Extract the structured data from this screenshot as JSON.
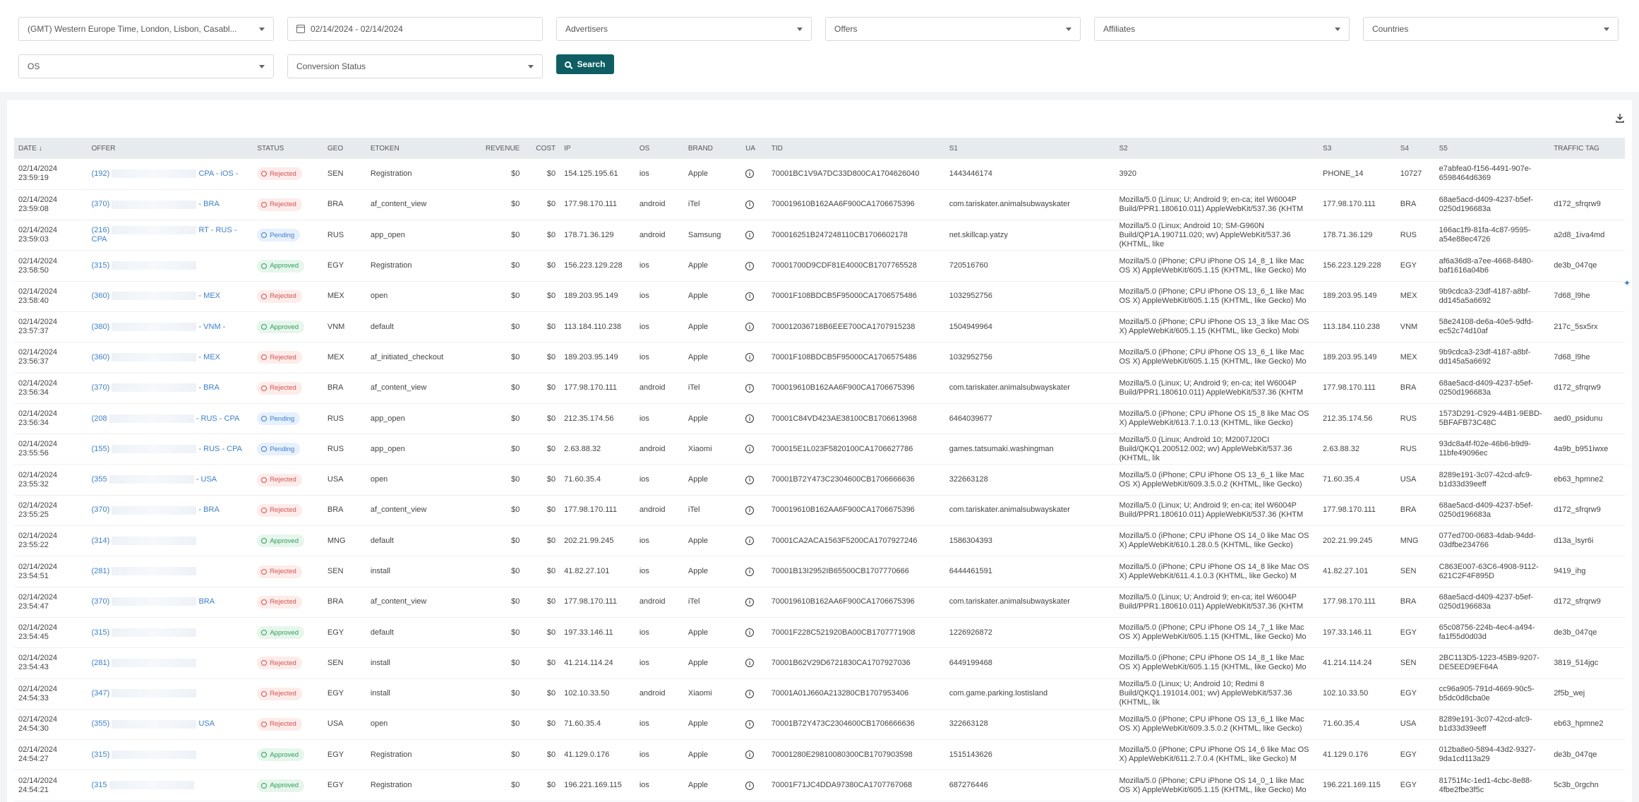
{
  "filters": {
    "timezone": "(GMT) Western Europe Time, London, Lisbon, Casabl...",
    "date_range": "02/14/2024 - 02/14/2024",
    "advertisers": "Advertisers",
    "offers": "Offers",
    "affiliates": "Affiliates",
    "countries": "Countries",
    "os": "OS",
    "conversion_status": "Conversion Status",
    "search_label": "Search"
  },
  "columns": [
    "DATE",
    "OFFER",
    "STATUS",
    "GEO",
    "ETOKEN",
    "REVENUE",
    "COST",
    "IP",
    "OS",
    "BRAND",
    "UA",
    "TID",
    "S1",
    "S2",
    "S3",
    "S4",
    "S5",
    "TRAFFIC TAG"
  ],
  "rows": [
    {
      "date": "02/14/2024",
      "time": "23:59:19",
      "offer_a": "(192)",
      "offer_b": "CPA - iOS -",
      "status": "Rejected",
      "geo": "SEN",
      "etoken": "Registration",
      "revenue": "$0",
      "cost": "$0",
      "ip": "154.125.195.61",
      "os": "ios",
      "brand": "Apple",
      "tid": "70001BC1V9A7DC33D800CA1704626040",
      "s1": "1443446174",
      "s2": "3920",
      "s3": "PHONE_14",
      "s4": "10727",
      "s5": "e7abfea0-f156-4491-907e-6598464d6369",
      "tag": ""
    },
    {
      "date": "02/14/2024",
      "time": "23:59:08",
      "offer_a": "(370)",
      "offer_b": "- BRA",
      "status": "Rejected",
      "geo": "BRA",
      "etoken": "af_content_view",
      "revenue": "$0",
      "cost": "$0",
      "ip": "177.98.170.111",
      "os": "android",
      "brand": "iTel",
      "tid": "700019610B162AA6F900CA1706675396",
      "s1": "com.tariskater.animalsubwayskater",
      "s2": "Mozilla/5.0 (Linux; U; Android 9; en-ca; itel W6004P Build/PPR1.180610.011) AppleWebKit/537.36 (KHTM",
      "s3": "177.98.170.111",
      "s4": "BRA",
      "s5": "68ae5acd-d409-4237-b5ef-0250d196683a",
      "tag": "d172_sfrqrw9"
    },
    {
      "date": "02/14/2024",
      "time": "23:59:03",
      "offer_a": "(216)",
      "offer_b": "RT - RUS - CPA",
      "status": "Pending",
      "geo": "RUS",
      "etoken": "app_open",
      "revenue": "$0",
      "cost": "$0",
      "ip": "178.71.36.129",
      "os": "android",
      "brand": "Samsung",
      "tid": "700016251B247248110CB1706602178",
      "s1": "net.skillcap.yatzy",
      "s2": "Mozilla/5.0 (Linux; Android 10; SM-G960N Build/QP1A.190711.020; wv) AppleWebKit/537.36 (KHTML, like",
      "s3": "178.71.36.129",
      "s4": "RUS",
      "s5": "166ac1f9-81fa-4c87-9595-a54e88ec4726",
      "tag": "a2d8_1iva4md"
    },
    {
      "date": "02/14/2024",
      "time": "23:58:50",
      "offer_a": "(315)",
      "offer_b": "",
      "status": "Approved",
      "geo": "EGY",
      "etoken": "Registration",
      "revenue": "$0",
      "cost": "$0",
      "ip": "156.223.129.228",
      "os": "ios",
      "brand": "Apple",
      "tid": "70001700D9CDF81E4000CB1707765528",
      "s1": "720516760",
      "s2": "Mozilla/5.0 (iPhone; CPU iPhone OS 14_8_1 like Mac OS X) AppleWebKit/605.1.15 (KHTML, like Gecko) Mo",
      "s3": "156.223.129.228",
      "s4": "EGY",
      "s5": "af6a36d8-a7ee-4668-8480-baf1616a04b6",
      "tag": "de3b_047qe"
    },
    {
      "date": "02/14/2024",
      "time": "23:58:40",
      "offer_a": "(360)",
      "offer_b": "- MEX",
      "status": "Rejected",
      "geo": "MEX",
      "etoken": "open",
      "revenue": "$0",
      "cost": "$0",
      "ip": "189.203.95.149",
      "os": "ios",
      "brand": "Apple",
      "tid": "70001F108BDCB5F95000CA1706575486",
      "s1": "1032952756",
      "s2": "Mozilla/5.0 (iPhone; CPU iPhone OS 13_6_1 like Mac OS X) AppleWebKit/605.1.15 (KHTML, like Gecko) Mo",
      "s3": "189.203.95.149",
      "s4": "MEX",
      "s5": "9b9cdca3-23df-4187-a8bf-dd145a5a6692",
      "tag": "7d68_l9he"
    },
    {
      "date": "02/14/2024",
      "time": "23:57:37",
      "offer_a": "(380)",
      "offer_b": "- VNM -",
      "status": "Approved",
      "geo": "VNM",
      "etoken": "default",
      "revenue": "$0",
      "cost": "$0",
      "ip": "113.184.110.238",
      "os": "ios",
      "brand": "Apple",
      "tid": "700012036718B6EEE700CA1707915238",
      "s1": "1504949964",
      "s2": "Mozilla/5.0 (iPhone; CPU iPhone OS 13_3 like Mac OS X) AppleWebKit/605.1.15 (KHTML, like Gecko) Mobi",
      "s3": "113.184.110.238",
      "s4": "VNM",
      "s5": "58e24108-de6a-40e5-9dfd-ec52c74d10af",
      "tag": "217c_5sx5rx"
    },
    {
      "date": "02/14/2024",
      "time": "23:56:37",
      "offer_a": "(360)",
      "offer_b": "- MEX",
      "status": "Rejected",
      "geo": "MEX",
      "etoken": "af_initiated_checkout",
      "revenue": "$0",
      "cost": "$0",
      "ip": "189.203.95.149",
      "os": "ios",
      "brand": "Apple",
      "tid": "70001F108BDCB5F95000CA1706575486",
      "s1": "1032952756",
      "s2": "Mozilla/5.0 (iPhone; CPU iPhone OS 13_6_1 like Mac OS X) AppleWebKit/605.1.15 (KHTML, like Gecko) Mo",
      "s3": "189.203.95.149",
      "s4": "MEX",
      "s5": "9b9cdca3-23df-4187-a8bf-dd145a5a6692",
      "tag": "7d68_l9he"
    },
    {
      "date": "02/14/2024",
      "time": "23:56:34",
      "offer_a": "(370)",
      "offer_b": "- BRA",
      "status": "Rejected",
      "geo": "BRA",
      "etoken": "af_content_view",
      "revenue": "$0",
      "cost": "$0",
      "ip": "177.98.170.111",
      "os": "android",
      "brand": "iTel",
      "tid": "700019610B162AA6F900CA1706675396",
      "s1": "com.tariskater.animalsubwayskater",
      "s2": "Mozilla/5.0 (Linux; U; Android 9; en-ca; itel W6004P Build/PPR1.180610.011) AppleWebKit/537.36 (KHTM",
      "s3": "177.98.170.111",
      "s4": "BRA",
      "s5": "68ae5acd-d409-4237-b5ef-0250d196683a",
      "tag": "d172_sfrqrw9"
    },
    {
      "date": "02/14/2024",
      "time": "23:56:34",
      "offer_a": "(208",
      "offer_b": "- RUS - CPA",
      "status": "Pending",
      "geo": "RUS",
      "etoken": "app_open",
      "revenue": "$0",
      "cost": "$0",
      "ip": "212.35.174.56",
      "os": "ios",
      "brand": "Apple",
      "tid": "70001C84VD423AE38100CB1706613968",
      "s1": "6464039677",
      "s2": "Mozilla/5.0 (iPhone; CPU iPhone OS 15_8 like Mac OS X) AppleWebKit/613.7.1.0.13 (KHTML, like Gecko)",
      "s3": "212.35.174.56",
      "s4": "RUS",
      "s5": "1573D291-C929-44B1-9EBD-5BFAFB73C48C",
      "tag": "aed0_psidunu"
    },
    {
      "date": "02/14/2024",
      "time": "23:55:56",
      "offer_a": "(155)",
      "offer_b": "- RUS - CPA",
      "status": "Pending",
      "geo": "RUS",
      "etoken": "app_open",
      "revenue": "$0",
      "cost": "$0",
      "ip": "2.63.88.32",
      "os": "android",
      "brand": "Xiaomi",
      "tid": "700015E1L023F5820100CA1706627786",
      "s1": "games.tatsumaki.washingman",
      "s2": "Mozilla/5.0 (Linux; Android 10; M2007J20CI Build/QKQ1.200512.002; wv) AppleWebKit/537.36 (KHTML, lik",
      "s3": "2.63.88.32",
      "s4": "RUS",
      "s5": "93dc8a4f-f02e-46b6-b9d9-11bfe49096ec",
      "tag": "4a9b_b951iwxe"
    },
    {
      "date": "02/14/2024",
      "time": "23:55:32",
      "offer_a": "(355",
      "offer_b": "- USA",
      "status": "Rejected",
      "geo": "USA",
      "etoken": "open",
      "revenue": "$0",
      "cost": "$0",
      "ip": "71.60.35.4",
      "os": "ios",
      "brand": "Apple",
      "tid": "70001B72Y473C2304600CB1706666636",
      "s1": "322663128",
      "s2": "Mozilla/5.0 (iPhone; CPU iPhone OS 13_6_1 like Mac OS X) AppleWebKit/609.3.5.0.2 (KHTML, like Gecko)",
      "s3": "71.60.35.4",
      "s4": "USA",
      "s5": "8289e191-3c07-42cd-afc9-b1d33d39eeff",
      "tag": "eb63_hpmne2"
    },
    {
      "date": "02/14/2024",
      "time": "23:55:25",
      "offer_a": "(370)",
      "offer_b": "- BRA",
      "status": "Rejected",
      "geo": "BRA",
      "etoken": "af_content_view",
      "revenue": "$0",
      "cost": "$0",
      "ip": "177.98.170.111",
      "os": "android",
      "brand": "iTel",
      "tid": "700019610B162AA6F900CA1706675396",
      "s1": "com.tariskater.animalsubwayskater",
      "s2": "Mozilla/5.0 (Linux; U; Android 9; en-ca; itel W6004P Build/PPR1.180610.011) AppleWebKit/537.36 (KHTM",
      "s3": "177.98.170.111",
      "s4": "BRA",
      "s5": "68ae5acd-d409-4237-b5ef-0250d196683a",
      "tag": "d172_sfrqrw9"
    },
    {
      "date": "02/14/2024",
      "time": "23:55:22",
      "offer_a": "(314)",
      "offer_b": "",
      "status": "Approved",
      "geo": "MNG",
      "etoken": "default",
      "revenue": "$0",
      "cost": "$0",
      "ip": "202.21.99.245",
      "os": "ios",
      "brand": "Apple",
      "tid": "70001CA2ACA1563F5200CA1707927246",
      "s1": "1586304393",
      "s2": "Mozilla/5.0 (iPhone; CPU iPhone OS 14_0 like Mac OS X) AppleWebKit/610.1.28.0.5 (KHTML, like Gecko)",
      "s3": "202.21.99.245",
      "s4": "MNG",
      "s5": "077ed700-0683-4dab-94dd-03dfbe234766",
      "tag": "d13a_lsyr6i"
    },
    {
      "date": "02/14/2024",
      "time": "23:54:51",
      "offer_a": "(281)",
      "offer_b": "",
      "status": "Rejected",
      "geo": "SEN",
      "etoken": "install",
      "revenue": "$0",
      "cost": "$0",
      "ip": "41.82.27.101",
      "os": "ios",
      "brand": "Apple",
      "tid": "70001B13I2952IB65500CB1707770666",
      "s1": "6444461591",
      "s2": "Mozilla/5.0 (iPhone; CPU iPhone OS 14_8 like Mac OS X) AppleWebKit/611.4.1.0.3 (KHTML, like Gecko) M",
      "s3": "41.82.27.101",
      "s4": "SEN",
      "s5": "C863E007-63C6-4908-9112-621C2F4F895D",
      "tag": "9419_ihg"
    },
    {
      "date": "02/14/2024",
      "time": "23:54:47",
      "offer_a": "(370)",
      "offer_b": "BRA",
      "status": "Rejected",
      "geo": "BRA",
      "etoken": "af_content_view",
      "revenue": "$0",
      "cost": "$0",
      "ip": "177.98.170.111",
      "os": "android",
      "brand": "iTel",
      "tid": "700019610B162AA6F900CA1706675396",
      "s1": "com.tariskater.animalsubwayskater",
      "s2": "Mozilla/5.0 (Linux; U; Android 9; en-ca; itel W6004P Build/PPR1.180610.011) AppleWebKit/537.36 (KHTM",
      "s3": "177.98.170.111",
      "s4": "BRA",
      "s5": "68ae5acd-d409-4237-b5ef-0250d196683a",
      "tag": "d172_sfrqrw9"
    },
    {
      "date": "02/14/2024",
      "time": "23:54:45",
      "offer_a": "(315)",
      "offer_b": "",
      "status": "Approved",
      "geo": "EGY",
      "etoken": "default",
      "revenue": "$0",
      "cost": "$0",
      "ip": "197.33.146.11",
      "os": "ios",
      "brand": "Apple",
      "tid": "70001F228C521920BA00CB1707771908",
      "s1": "1226926872",
      "s2": "Mozilla/5.0 (iPhone; CPU iPhone OS 14_7_1 like Mac OS X) AppleWebKit/605.1.15 (KHTML, like Gecko) Mo",
      "s3": "197.33.146.11",
      "s4": "EGY",
      "s5": "65c08756-224b-4ec4-a494-fa1f55d0d03d",
      "tag": "de3b_047qe"
    },
    {
      "date": "02/14/2024",
      "time": "23:54:43",
      "offer_a": "(281)",
      "offer_b": "",
      "status": "Rejected",
      "geo": "SEN",
      "etoken": "install",
      "revenue": "$0",
      "cost": "$0",
      "ip": "41.214.114.24",
      "os": "ios",
      "brand": "Apple",
      "tid": "70001B62V29D6721830CA1707927036",
      "s1": "6449199468",
      "s2": "Mozilla/5.0 (iPhone; CPU iPhone OS 14_8_1 like Mac OS X) AppleWebKit/605.1.15 (KHTML, like Gecko) Mo",
      "s3": "41.214.114.24",
      "s4": "SEN",
      "s5": "2BC113D5-1223-45B9-9207-DE5EED9EF64A",
      "tag": "3819_514jgc"
    },
    {
      "date": "02/14/2024",
      "time": "24:54:33",
      "offer_a": "(347)",
      "offer_b": "",
      "status": "Rejected",
      "geo": "EGY",
      "etoken": "install",
      "revenue": "$0",
      "cost": "$0",
      "ip": "102.10.33.50",
      "os": "android",
      "brand": "Xiaomi",
      "tid": "70001A01J660A213280CB1707953406",
      "s1": "com.game.parking.lostisland",
      "s2": "Mozilla/5.0 (Linux; U; Android 10; Redmi 8 Build/QKQ1.191014.001; wv) AppleWebKit/537.36 (KHTML, lik",
      "s3": "102.10.33.50",
      "s4": "EGY",
      "s5": "cc96a905-791d-4669-90c5-b5dc0d8cba0e",
      "tag": "2f5b_wej"
    },
    {
      "date": "02/14/2024",
      "time": "24:54:30",
      "offer_a": "(355)",
      "offer_b": "USA",
      "status": "Rejected",
      "geo": "USA",
      "etoken": "open",
      "revenue": "$0",
      "cost": "$0",
      "ip": "71.60.35.4",
      "os": "ios",
      "brand": "Apple",
      "tid": "70001B72Y473C2304600CB1706666636",
      "s1": "322663128",
      "s2": "Mozilla/5.0 (iPhone; CPU iPhone OS 13_6_1 like Mac OS X) AppleWebKit/609.3.5.0.2 (KHTML, like Gecko)",
      "s3": "71.60.35.4",
      "s4": "USA",
      "s5": "8289e191-3c07-42cd-afc9-b1d33d39eeff",
      "tag": "eb63_hpmne2"
    },
    {
      "date": "02/14/2024",
      "time": "24:54:27",
      "offer_a": "(315)",
      "offer_b": "",
      "status": "Approved",
      "geo": "EGY",
      "etoken": "Registration",
      "revenue": "$0",
      "cost": "$0",
      "ip": "41.129.0.176",
      "os": "ios",
      "brand": "Apple",
      "tid": "70001280E29810080300CB1707903598",
      "s1": "1515143626",
      "s2": "Mozilla/5.0 (iPhone; CPU iPhone OS 14_6 like Mac OS X) AppleWebKit/611.2.7.0.4 (KHTML, like Gecko) M",
      "s3": "41.129.0.176",
      "s4": "EGY",
      "s5": "012ba8e0-5894-43d2-9327-9da1cd113a29",
      "tag": "de3b_047qe"
    },
    {
      "date": "02/14/2024",
      "time": "24:54:21",
      "offer_a": "(315",
      "offer_b": "",
      "status": "Approved",
      "geo": "EGY",
      "etoken": "Registration",
      "revenue": "$0",
      "cost": "$0",
      "ip": "196.221.169.115",
      "os": "ios",
      "brand": "Apple",
      "tid": "70001F71JC4DDA97380CA1707767068",
      "s1": "687276446",
      "s2": "Mozilla/5.0 (iPhone; CPU iPhone OS 14_0_1 like Mac OS X) AppleWebKit/605.1.15 (KHTML, like Gecko) Mo",
      "s3": "196.221.169.115",
      "s4": "EGY",
      "s5": "81751f4c-1ed1-4cbc-8e88-4fbe2fbe3f5c",
      "tag": "5c3b_0rgchn"
    }
  ],
  "colors": {
    "accent": "#0e5e63",
    "rejected": "#d9534f",
    "pending": "#3b7fd3",
    "approved": "#2e9e5b"
  }
}
